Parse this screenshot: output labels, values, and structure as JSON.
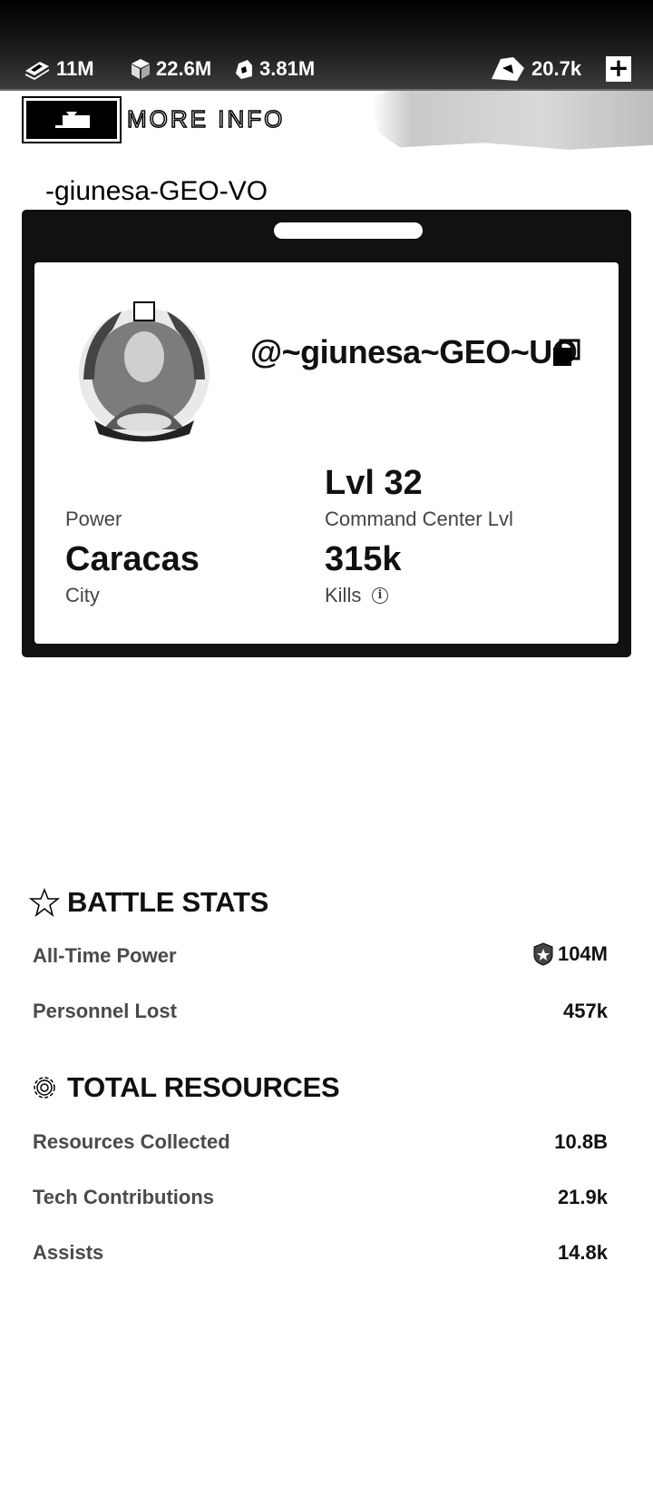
{
  "resources": {
    "cash": {
      "icon": "cash-stack-icon",
      "value": "11M"
    },
    "supplies": {
      "icon": "supply-crate-icon",
      "value": "22.6M"
    },
    "fuel": {
      "icon": "fuel-canister-icon",
      "value": "3.81M"
    },
    "premium": {
      "icon": "premium-currency-icon",
      "value": "20.7k",
      "add_label": "+"
    }
  },
  "header": {
    "more_info_label": "MORE INFO"
  },
  "page_title": "-giunesa-GEO-VO",
  "profile": {
    "username": "@~giunesa~GEO~UO",
    "level": "Lvl 32",
    "level_label": "Command Center Lvl",
    "power_label": "Power",
    "city": "Caracas",
    "city_label": "City",
    "kills": "315k",
    "kills_label": "Kills"
  },
  "battle_stats": {
    "title": "BATTLE STATS",
    "rows": [
      {
        "label": "All-Time Power",
        "value": "104M"
      },
      {
        "label": "Personnel Lost",
        "value": "457k"
      }
    ]
  },
  "total_resources": {
    "title": "TOTAL RESOURCES",
    "rows": [
      {
        "label": "Resources Collected",
        "value": "10.8B"
      },
      {
        "label": "Tech Contributions",
        "value": "21.9k"
      },
      {
        "label": "Assists",
        "value": "14.8k"
      }
    ]
  }
}
